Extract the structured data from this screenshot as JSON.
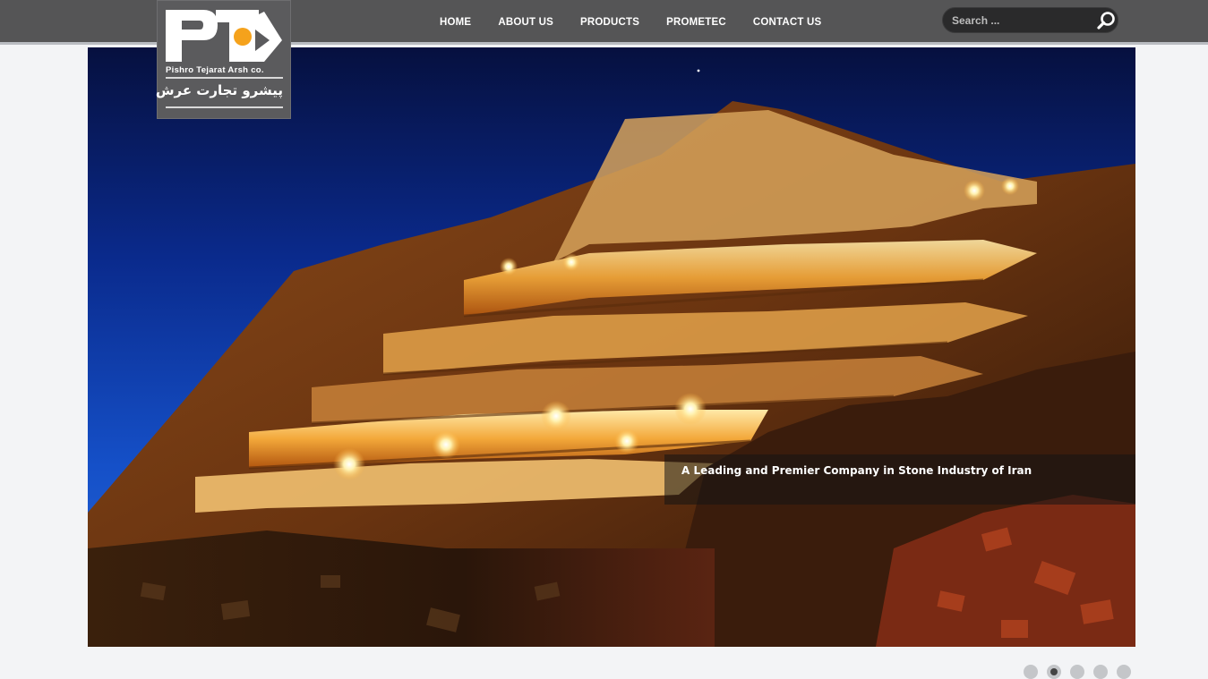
{
  "brand": {
    "logo_letters": "PT",
    "name_en": "Pishro Tejarat Arsh co.",
    "name_fa": "پیشرو تجارت عرش",
    "colors": {
      "accent": "#f5a21c",
      "header_bg": "#555556"
    }
  },
  "nav": {
    "items": [
      {
        "label": "HOME"
      },
      {
        "label": "ABOUT US"
      },
      {
        "label": "PRODUCTS"
      },
      {
        "label": "PROMETEC"
      },
      {
        "label": "CONTACT US"
      }
    ]
  },
  "search": {
    "placeholder": "Search ...",
    "icon": "search-icon"
  },
  "slider": {
    "image": "stone-quarry-at-night",
    "caption": "A Leading and Premier Company in Stone Industry of Iran",
    "slide_count": 5,
    "active_slide": 2
  }
}
